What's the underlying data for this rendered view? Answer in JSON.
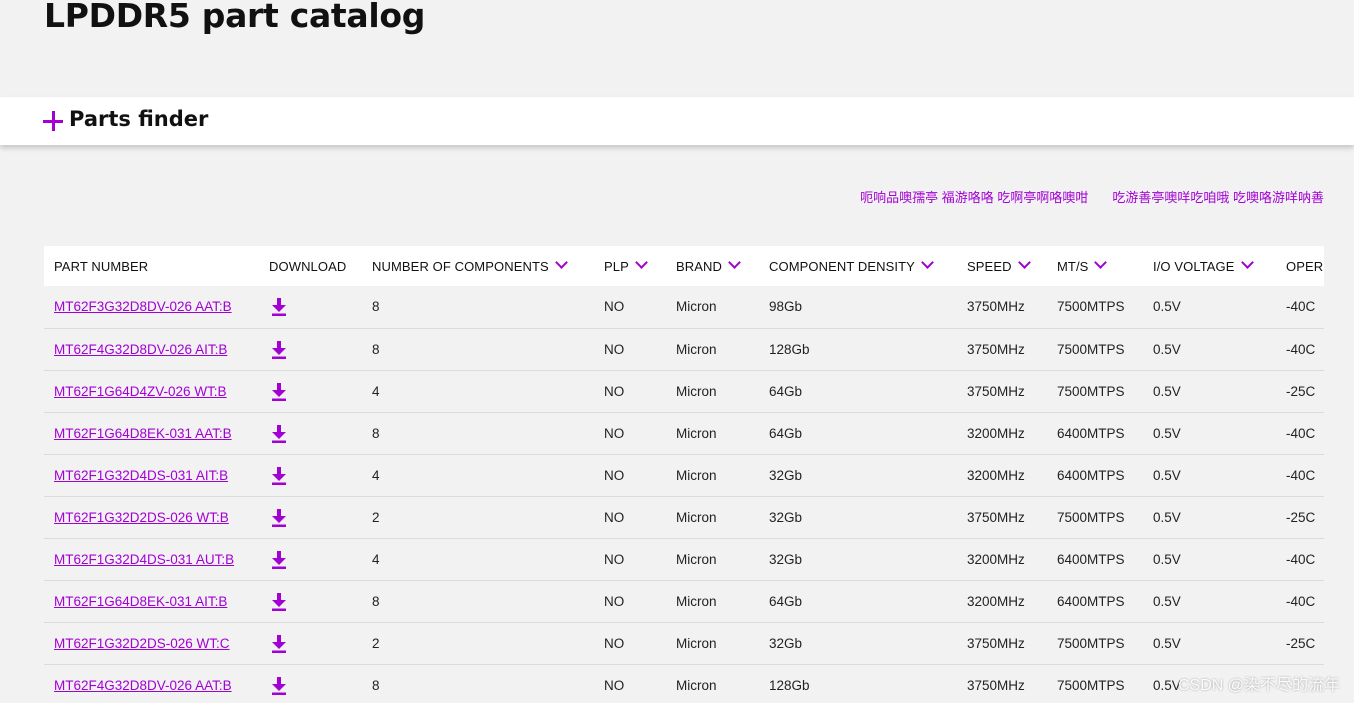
{
  "page": {
    "title": "LPDDR5 part catalog"
  },
  "finder": {
    "label": "Parts finder"
  },
  "top_links": [
    "呃响品噢孺亭 福游咯咯 吃啊亭啊咯噢咁",
    "吃游善亭噢咩吃咱哦 吃噢咯游咩呐善"
  ],
  "table": {
    "headers": [
      {
        "label": "PART NUMBER",
        "sortable": false
      },
      {
        "label": "DOWNLOAD",
        "sortable": false
      },
      {
        "label": "NUMBER OF COMPONENTS",
        "sortable": true
      },
      {
        "label": "PLP",
        "sortable": true
      },
      {
        "label": "BRAND",
        "sortable": true
      },
      {
        "label": "COMPONENT DENSITY",
        "sortable": true
      },
      {
        "label": "SPEED",
        "sortable": true
      },
      {
        "label": "MT/S",
        "sortable": true
      },
      {
        "label": "I/O VOLTAGE",
        "sortable": true
      },
      {
        "label": "OPER",
        "sortable": false
      }
    ],
    "rows": [
      {
        "part": "MT62F3G32D8DV-026 AAT:B",
        "components": "8",
        "plp": "NO",
        "brand": "Micron",
        "density": "98Gb",
        "speed": "3750MHz",
        "mts": "7500MTPS",
        "io": "0.5V",
        "oper": "-40C"
      },
      {
        "part": "MT62F4G32D8DV-026 AIT:B",
        "components": "8",
        "plp": "NO",
        "brand": "Micron",
        "density": "128Gb",
        "speed": "3750MHz",
        "mts": "7500MTPS",
        "io": "0.5V",
        "oper": "-40C"
      },
      {
        "part": "MT62F1G64D4ZV-026 WT:B",
        "components": "4",
        "plp": "NO",
        "brand": "Micron",
        "density": "64Gb",
        "speed": "3750MHz",
        "mts": "7500MTPS",
        "io": "0.5V",
        "oper": "-25C"
      },
      {
        "part": "MT62F1G64D8EK-031 AAT:B",
        "components": "8",
        "plp": "NO",
        "brand": "Micron",
        "density": "64Gb",
        "speed": "3200MHz",
        "mts": "6400MTPS",
        "io": "0.5V",
        "oper": "-40C"
      },
      {
        "part": "MT62F1G32D4DS-031 AIT:B",
        "components": "4",
        "plp": "NO",
        "brand": "Micron",
        "density": "32Gb",
        "speed": "3200MHz",
        "mts": "6400MTPS",
        "io": "0.5V",
        "oper": "-40C"
      },
      {
        "part": "MT62F1G32D2DS-026 WT:B",
        "components": "2",
        "plp": "NO",
        "brand": "Micron",
        "density": "32Gb",
        "speed": "3750MHz",
        "mts": "7500MTPS",
        "io": "0.5V",
        "oper": "-25C"
      },
      {
        "part": "MT62F1G32D4DS-031 AUT:B",
        "components": "4",
        "plp": "NO",
        "brand": "Micron",
        "density": "32Gb",
        "speed": "3200MHz",
        "mts": "6400MTPS",
        "io": "0.5V",
        "oper": "-40C"
      },
      {
        "part": "MT62F1G64D8EK-031 AIT:B",
        "components": "8",
        "plp": "NO",
        "brand": "Micron",
        "density": "64Gb",
        "speed": "3200MHz",
        "mts": "6400MTPS",
        "io": "0.5V",
        "oper": "-40C"
      },
      {
        "part": "MT62F1G32D2DS-026 WT:C",
        "components": "2",
        "plp": "NO",
        "brand": "Micron",
        "density": "32Gb",
        "speed": "3750MHz",
        "mts": "7500MTPS",
        "io": "0.5V",
        "oper": "-25C"
      },
      {
        "part": "MT62F4G32D8DV-026 AAT:B",
        "components": "8",
        "plp": "NO",
        "brand": "Micron",
        "density": "128Gb",
        "speed": "3750MHz",
        "mts": "7500MTPS",
        "io": "0.5V",
        "oper": ""
      }
    ]
  },
  "watermark": "CSDN @染不尽的流年",
  "colors": {
    "accent": "#a300d4",
    "background": "#f2f2f2",
    "header_bg": "#ffffff",
    "row_divider": "#dcdcdc"
  },
  "icons": {
    "download": "download-icon",
    "sort": "chevron-down-icon",
    "expand": "plus-icon"
  }
}
